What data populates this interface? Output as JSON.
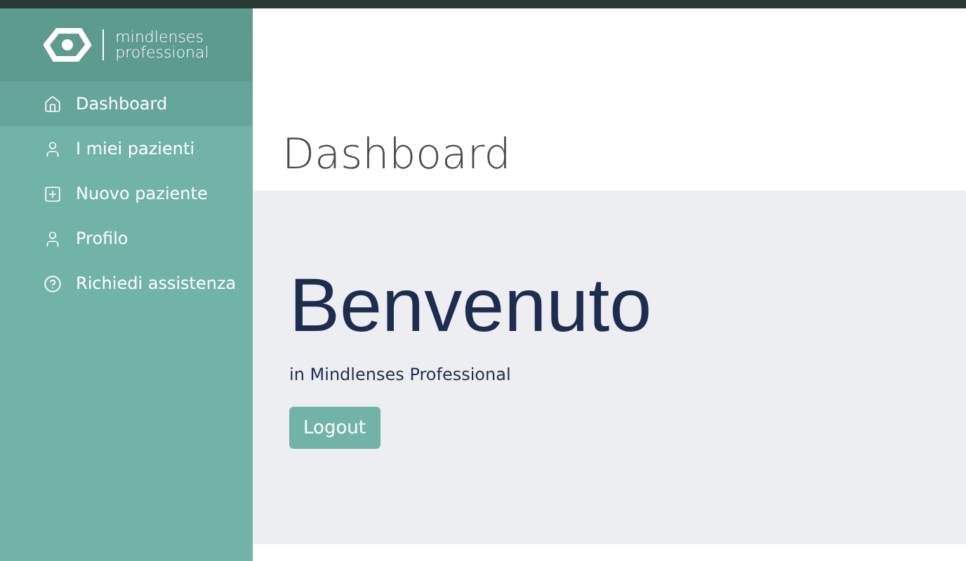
{
  "logo": {
    "line_1": "mindlenses",
    "line_2": "professional"
  },
  "sidebar": {
    "items": [
      {
        "label": "Dashboard",
        "kind": "home",
        "selected": true
      },
      {
        "label": "I miei pazienti",
        "kind": "user",
        "selected": false
      },
      {
        "label": "Nuovo paziente",
        "kind": "add",
        "selected": false
      },
      {
        "label": "Profilo",
        "kind": "user",
        "selected": false
      },
      {
        "label": "Richiedi assistenza",
        "kind": "help",
        "selected": false
      }
    ]
  },
  "header": {
    "title": "Dashboard"
  },
  "welcome": {
    "heading": "Benvenuto",
    "subtitle": "in Mindlenses Professional",
    "button": "Logout"
  }
}
